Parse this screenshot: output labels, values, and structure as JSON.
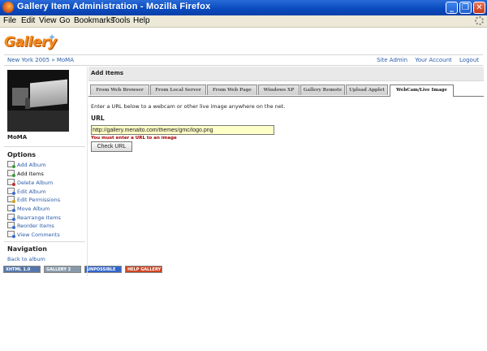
{
  "window": {
    "title": "Gallery Item Administration - Mozilla Firefox",
    "minimize": "_",
    "maximize": "❐",
    "close": "✕"
  },
  "menu": {
    "items": [
      "File",
      "Edit",
      "View",
      "Go",
      "Bookmarks",
      "Tools",
      "Help"
    ]
  },
  "logo": {
    "text": "Gallery"
  },
  "breadcrumb": {
    "album": "New York 2005",
    "separator": "»",
    "current": "MoMA"
  },
  "toplinks": {
    "site_admin": "Site Admin",
    "your_account": "Your Account",
    "logout": "Logout"
  },
  "sidebar": {
    "thumb_caption": "MoMA",
    "options_title": "Options",
    "options": [
      {
        "label": "Add Album",
        "icon": "add-album-icon",
        "color": "#3a9a3a"
      },
      {
        "label": "Add Items",
        "icon": "add-items-icon",
        "color": "#3a9a3a"
      },
      {
        "label": "Delete Album",
        "icon": "delete-album-icon",
        "color": "#c03030"
      },
      {
        "label": "Edit Album",
        "icon": "edit-album-icon",
        "color": "#3a6ad0"
      },
      {
        "label": "Edit Permissions",
        "icon": "edit-permissions-icon",
        "color": "#d0a020"
      },
      {
        "label": "Move Album",
        "icon": "move-album-icon",
        "color": "#3a6ad0"
      },
      {
        "label": "Rearrange Items",
        "icon": "rearrange-items-icon",
        "color": "#3a6ad0"
      },
      {
        "label": "Reorder Items",
        "icon": "reorder-items-icon",
        "color": "#3a6ad0"
      },
      {
        "label": "View Comments",
        "icon": "view-comments-icon",
        "color": "#3a6ad0"
      }
    ],
    "navigation_title": "Navigation",
    "back_link": "Back to album"
  },
  "badges": [
    {
      "text": "XHTML 1.0",
      "color": "#5577aa"
    },
    {
      "text": "GALLERY 2",
      "color": "#8899aa"
    },
    {
      "text": "UNPOSSIBLE",
      "color": "#3366cc"
    },
    {
      "text": "HELP GALLERY",
      "color": "#cc4422"
    }
  ],
  "main": {
    "heading": "Add Items",
    "tabs": [
      "From Web Browser",
      "From Local Server",
      "From Web Page",
      "Windows XP",
      "Gallery Remote",
      "Upload Applet",
      "WebCam/Live Image"
    ],
    "active_tab": 6,
    "intro": "Enter a URL below to a webcam or other live image anywhere on the net.",
    "url_label": "URL",
    "url_value": "http://gallery.menalto.com/themes/gmc/logo.png",
    "error": "You must enter a URL to an image",
    "button": "Check URL"
  }
}
